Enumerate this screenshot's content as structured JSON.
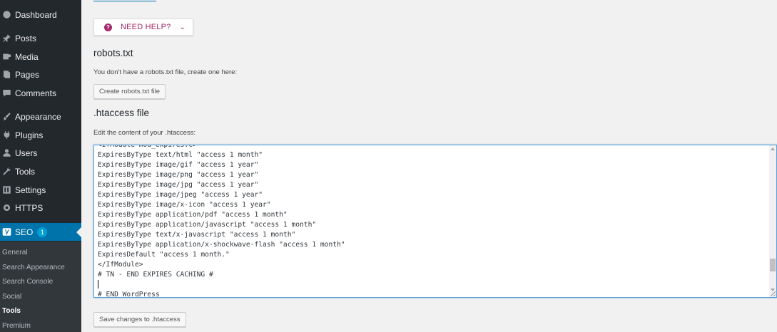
{
  "sidebar": {
    "items": [
      {
        "label": "Dashboard",
        "icon": "dashboard-icon"
      },
      {
        "label": "Posts",
        "icon": "pushpin-icon"
      },
      {
        "label": "Media",
        "icon": "media-icon"
      },
      {
        "label": "Pages",
        "icon": "pages-icon"
      },
      {
        "label": "Comments",
        "icon": "comment-icon"
      },
      {
        "label": "Appearance",
        "icon": "paintbrush-icon"
      },
      {
        "label": "Plugins",
        "icon": "plugin-icon"
      },
      {
        "label": "Users",
        "icon": "user-icon"
      },
      {
        "label": "Tools",
        "icon": "wrench-icon"
      },
      {
        "label": "Settings",
        "icon": "settings-icon"
      },
      {
        "label": "HTTPS",
        "icon": "gear-icon"
      }
    ],
    "seo": {
      "label": "SEO",
      "badge": "1",
      "icon": "yoast-icon"
    },
    "submenu": [
      "General",
      "Search Appearance",
      "Search Console",
      "Social",
      "Tools",
      "Premium"
    ],
    "current_submenu": "Tools"
  },
  "help": {
    "label": "NEED HELP?",
    "icon": "question-icon",
    "chevron": "chevron-down-icon"
  },
  "robots": {
    "title": "robots.txt",
    "description": "You don't have a robots.txt file, create one here:",
    "button": "Create robots.txt file"
  },
  "htaccess": {
    "title": ".htaccess file",
    "description": "Edit the content of your .htaccess:",
    "lines": [
      "<IfModule mod_expires.c>",
      "ExpiresByType text/html \"access 1 month\"",
      "ExpiresByType image/gif \"access 1 year\"",
      "ExpiresByType image/png \"access 1 year\"",
      "ExpiresByType image/jpg \"access 1 year\"",
      "ExpiresByType image/jpeg \"access 1 year\"",
      "ExpiresByType image/x-icon \"access 1 year\"",
      "ExpiresByType application/pdf \"access 1 month\"",
      "ExpiresByType application/javascript \"access 1 month\"",
      "ExpiresByType text/x-javascript \"access 1 month\"",
      "ExpiresByType application/x-shockwave-flash \"access 1 month\"",
      "ExpiresDefault \"access 1 month.\"",
      "</IfModule>",
      "# TN - END EXPIRES CACHING #",
      "",
      "# END WordPress"
    ],
    "save_button": "Save changes to .htaccess"
  },
  "colors": {
    "sidebar_bg": "#23282d",
    "submenu_bg": "#32373c",
    "active_bg": "#0073aa",
    "accent_help": "#a4286a",
    "badge": "#00a0d2"
  }
}
